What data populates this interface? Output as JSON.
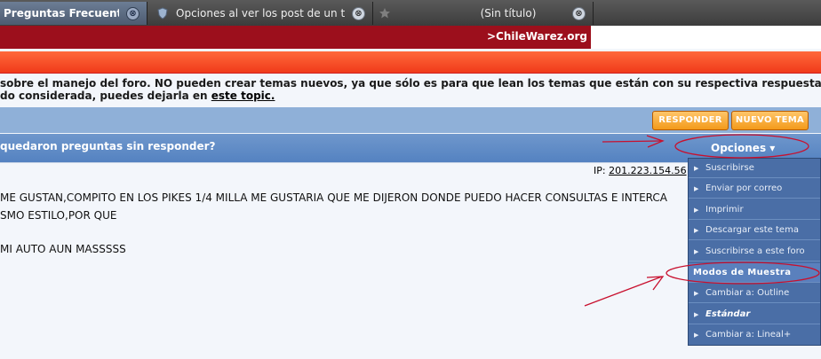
{
  "browser": {
    "tabs": [
      {
        "title": "Preguntas Frecuentes ...",
        "active": true
      },
      {
        "title": "Opciones al ver los post de un t...",
        "active": false
      },
      {
        "title": "(Sin título)",
        "active": false
      }
    ],
    "close_glyph": "⊗"
  },
  "site": {
    "brand_link": ">ChileWarez.org"
  },
  "notice": {
    "line1": "sobre el manejo del foro. NO pueden crear temas nuevos, ya que sólo es para que lean los temas que están con su respectiva respuesta.",
    "line2_prefix": "do considerada, puedes dejarla en ",
    "line2_link": "este topic."
  },
  "toolbar": {
    "reply_label": "RESPONDER",
    "new_topic_label": "NUEVO TEMA"
  },
  "post": {
    "title": "quedaron preguntas sin responder?",
    "options_label": "Opciones ▾",
    "ip_label": "IP: ",
    "ip_value": "201.223.154.56",
    "lines": [
      "ME GUSTAN,COMPITO EN LOS PIKES 1/4 MILLA ME GUSTARIA QUE ME DIJERON DONDE PUEDO HACER CONSULTAS E INTERCA",
      "SMO ESTILO,POR QUE",
      "MI AUTO AUN MASSSSS"
    ]
  },
  "menu": {
    "arrow": "▶",
    "items": [
      "Suscribirse",
      "Enviar por correo",
      "Imprimir",
      "Descargar este tema",
      "Suscribirse a este foro"
    ],
    "display_header": "Modos de Muestra",
    "display_items": [
      "Cambiar a: Outline",
      "Estándar",
      "Cambiar a: Lineal+"
    ]
  },
  "colors": {
    "brand_red": "#9c0f1c",
    "orange": "#f03a1a",
    "button_orange": "#f39a1a",
    "header_blue": "#5482c1",
    "menu_blue": "#4a6ea6",
    "annotation_red": "#c8102e"
  }
}
